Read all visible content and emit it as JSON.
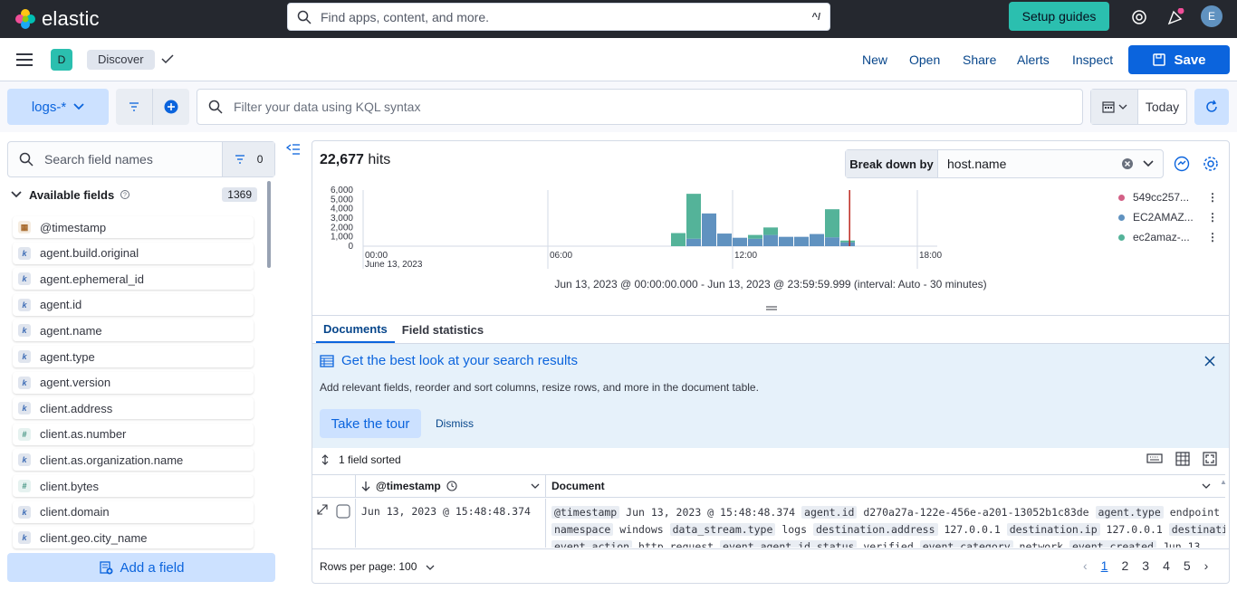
{
  "topbar": {
    "brand": "elastic",
    "search_placeholder": "Find apps, content, and more.",
    "search_shortcut": "^/",
    "setup_guides": "Setup guides",
    "avatar_initial": "E"
  },
  "appbar": {
    "space_initial": "D",
    "breadcrumb": "Discover",
    "links": [
      "New",
      "Open",
      "Share",
      "Alerts",
      "Inspect"
    ],
    "save_label": "Save"
  },
  "querybar": {
    "data_view": "logs-*",
    "kql_placeholder": "Filter your data using KQL syntax",
    "date_label": "Today"
  },
  "sidebar": {
    "search_placeholder": "Search field names",
    "filter_count": "0",
    "available_label": "Available fields",
    "available_count": "1369",
    "fields": [
      {
        "name": "@timestamp",
        "type": "date"
      },
      {
        "name": "agent.build.original",
        "type": "keyword"
      },
      {
        "name": "agent.ephemeral_id",
        "type": "keyword"
      },
      {
        "name": "agent.id",
        "type": "keyword"
      },
      {
        "name": "agent.name",
        "type": "keyword"
      },
      {
        "name": "agent.type",
        "type": "keyword"
      },
      {
        "name": "agent.version",
        "type": "keyword"
      },
      {
        "name": "client.address",
        "type": "keyword"
      },
      {
        "name": "client.as.number",
        "type": "number"
      },
      {
        "name": "client.as.organization.name",
        "type": "keyword"
      },
      {
        "name": "client.bytes",
        "type": "number"
      },
      {
        "name": "client.domain",
        "type": "keyword"
      },
      {
        "name": "client.geo.city_name",
        "type": "keyword"
      }
    ],
    "add_field": "Add a field"
  },
  "main": {
    "hits_count": "22,677",
    "hits_label": "hits",
    "breakdown_label": "Break down by",
    "breakdown_value": "host.name",
    "range_text": "Jun 13, 2023 @ 00:00:00.000 - Jun 13, 2023 @ 23:59:59.999 (interval: Auto - 30 minutes)",
    "tabs": [
      "Documents",
      "Field statistics"
    ],
    "callout_title": "Get the best look at your search results",
    "callout_text": "Add relevant fields, reorder and sort columns, resize rows, and more in the document table.",
    "tour_button": "Take the tour",
    "dismiss_button": "Dismiss",
    "sorted_label": "1 field sorted",
    "col_timestamp": "@timestamp",
    "col_document": "Document",
    "row_timestamp": "Jun 13, 2023 @ 15:48:48.374",
    "doc_line1": [
      [
        "@timestamp",
        "Jun 13, 2023 @ 15:48:48.374"
      ],
      [
        "agent.id",
        "d270a27a-122e-456e-a201-13052b1c83de"
      ],
      [
        "agent.type",
        "endpoint"
      ]
    ],
    "doc_line2": [
      [
        "namespace",
        "windows"
      ],
      [
        "data_stream.type",
        "logs"
      ],
      [
        "destination.address",
        "127.0.0.1"
      ],
      [
        "destination.ip",
        "127.0.0.1"
      ],
      [
        "destination.port",
        ""
      ]
    ],
    "doc_line3": [
      [
        "event.action",
        "http_request"
      ],
      [
        "event.agent_id_status",
        "verified"
      ],
      [
        "event.category",
        "network"
      ],
      [
        "event.created",
        "Jun 13"
      ]
    ],
    "rows_per_page": "Rows per page: 100",
    "pages": [
      "1",
      "2",
      "3",
      "4",
      "5"
    ]
  },
  "chart_data": {
    "type": "bar",
    "stacked": true,
    "x_ticks": [
      "00:00",
      "06:00",
      "12:00",
      "18:00"
    ],
    "x_sublabel": "June 13, 2023",
    "y_ticks": [
      "0",
      "1,000",
      "2,000",
      "3,000",
      "4,000",
      "5,000",
      "6,000"
    ],
    "ylim": [
      0,
      6000
    ],
    "interval": "30 minutes",
    "x": [
      "10:00",
      "10:30",
      "11:00",
      "11:30",
      "12:00",
      "12:30",
      "13:00",
      "13:30",
      "14:00",
      "14:30",
      "15:00",
      "15:30"
    ],
    "series": [
      {
        "name": "549cc257...",
        "color": "#d36086",
        "values": [
          0,
          0,
          0,
          0,
          0,
          0,
          0,
          0,
          0,
          0,
          0,
          0
        ]
      },
      {
        "name": "EC2AMAZ...",
        "color": "#6092c0",
        "values": [
          0,
          800,
          3500,
          1350,
          900,
          800,
          1200,
          1000,
          1000,
          1300,
          950,
          400
        ]
      },
      {
        "name": "ec2amaz-...",
        "color": "#54b399",
        "values": [
          1400,
          4800,
          0,
          0,
          0,
          400,
          800,
          0,
          0,
          0,
          3000,
          200
        ]
      }
    ],
    "now_marker": "15:48"
  },
  "colors": {
    "accent": "#0b64dd",
    "topbar_bg": "#25282f",
    "teal": "#2bbfaf"
  }
}
